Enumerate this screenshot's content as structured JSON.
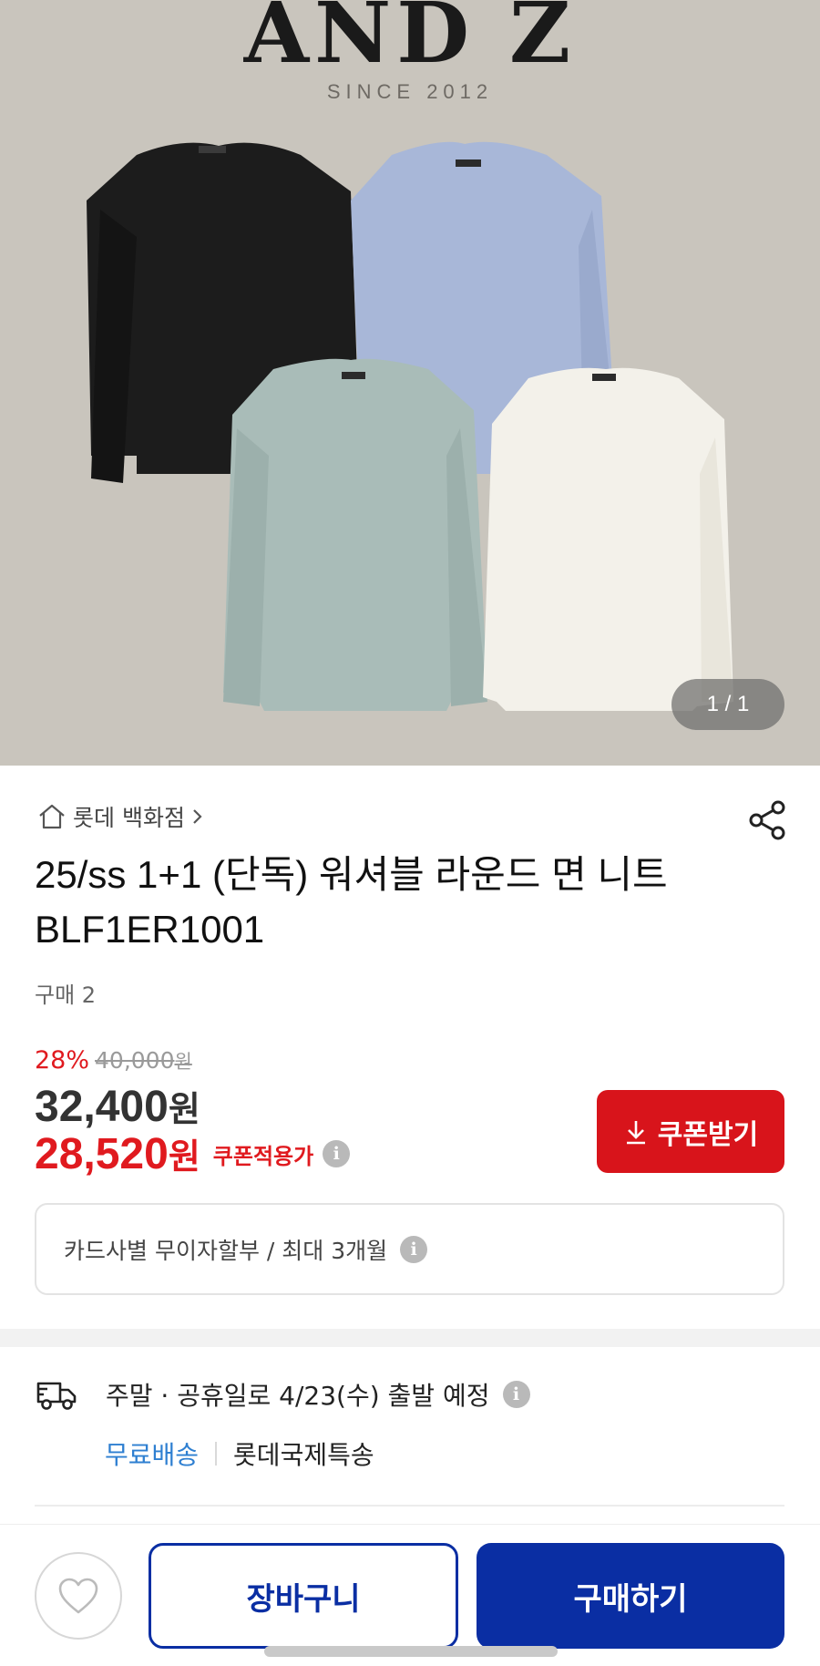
{
  "hero": {
    "brand": "AND Z",
    "since": "SINCE 2012",
    "counter": "1 / 1",
    "background_color": "#c9c5bd",
    "sweater_colors": [
      "#1c1c1c",
      "#a8b7d8",
      "#a9bcb8",
      "#f3f1ea"
    ]
  },
  "store": {
    "name": "롯데 백화점",
    "icon": "home-icon"
  },
  "product": {
    "title": "25/ss 1+1 (단독) 워셔블 라운드 면 니트 BLF1ER1001",
    "purchase_count": "구매 2"
  },
  "price": {
    "discount_rate": "28%",
    "original": "40,000",
    "original_unit": "원",
    "sale": "32,400",
    "sale_unit": "원",
    "coupon_price": "28,520",
    "coupon_unit": "원",
    "coupon_label": "쿠폰적용가",
    "accent_color": "#e01a1f"
  },
  "coupon_button": {
    "label": "쿠폰받기",
    "icon": "download-arrow-icon"
  },
  "installment": {
    "text": "카드사별 무이자할부 / 최대 3개월"
  },
  "shipping": {
    "text": "주말 · 공휴일로 4/23(수) 출발 예정",
    "free_label": "무료배송",
    "carrier": "롯데국제특송",
    "icon": "truck-icon"
  },
  "bottom_bar": {
    "wishlist_icon": "heart-icon",
    "cart_label": "장바구니",
    "buy_label": "구매하기",
    "primary_color": "#0a2ea3"
  },
  "info_glyph": "i"
}
